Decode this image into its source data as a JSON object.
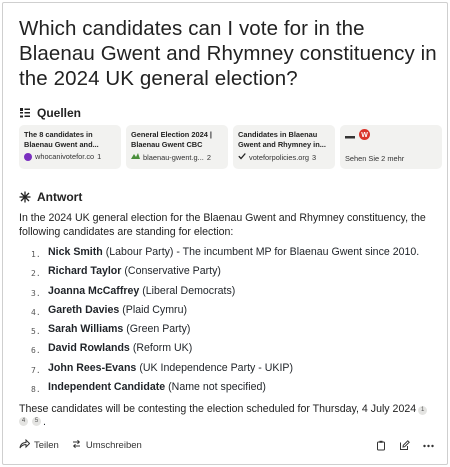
{
  "question": "Which candidates can I vote for in the Blaenau Gwent and Rhymney constituency in the 2024 UK general election?",
  "sources": {
    "heading": "Quellen",
    "cards": [
      {
        "title": "The 8 candidates in Blaenau Gwent and...",
        "domain": "whocanivotefor.co",
        "index": "1"
      },
      {
        "title": "General Election 2024 | Blaenau Gwent CBC",
        "domain": "blaenau-gwent.g...",
        "index": "2"
      },
      {
        "title": "Candidates in Blaenau Gwent and Rhymney in...",
        "domain": "voteforpolicies.org",
        "index": "3"
      }
    ],
    "more_label": "Sehen Sie 2 mehr"
  },
  "answer": {
    "heading": "Antwort",
    "intro": "In the 2024 UK general election for the Blaenau Gwent and Rhymney constituency, the following candidates are standing for election:",
    "candidates": [
      {
        "num": "1.",
        "name": "Nick Smith",
        "detail": "(Labour Party) - The incumbent MP for Blaenau Gwent since 2010."
      },
      {
        "num": "2.",
        "name": "Richard Taylor",
        "detail": "(Conservative Party)"
      },
      {
        "num": "3.",
        "name": "Joanna McCaffrey",
        "detail": "(Liberal Democrats)"
      },
      {
        "num": "4.",
        "name": "Gareth Davies",
        "detail": "(Plaid Cymru)"
      },
      {
        "num": "5.",
        "name": "Sarah Williams",
        "detail": "(Green Party)"
      },
      {
        "num": "6.",
        "name": "David Rowlands",
        "detail": "(Reform UK)"
      },
      {
        "num": "7.",
        "name": "John Rees-Evans",
        "detail": "(UK Independence Party - UKIP)"
      },
      {
        "num": "8.",
        "name": "Independent Candidate",
        "detail": "(Name not specified)"
      }
    ],
    "closing": "These candidates will be contesting the election scheduled for Thursday, 4 July 2024",
    "citations": [
      "1",
      "4",
      "5"
    ]
  },
  "toolbar": {
    "share_label": "Teilen",
    "rewrite_label": "Umschreiben"
  },
  "colors": {
    "card_bg": "#f2f2f0",
    "text": "#222222",
    "wiki_red": "#d9342b"
  }
}
